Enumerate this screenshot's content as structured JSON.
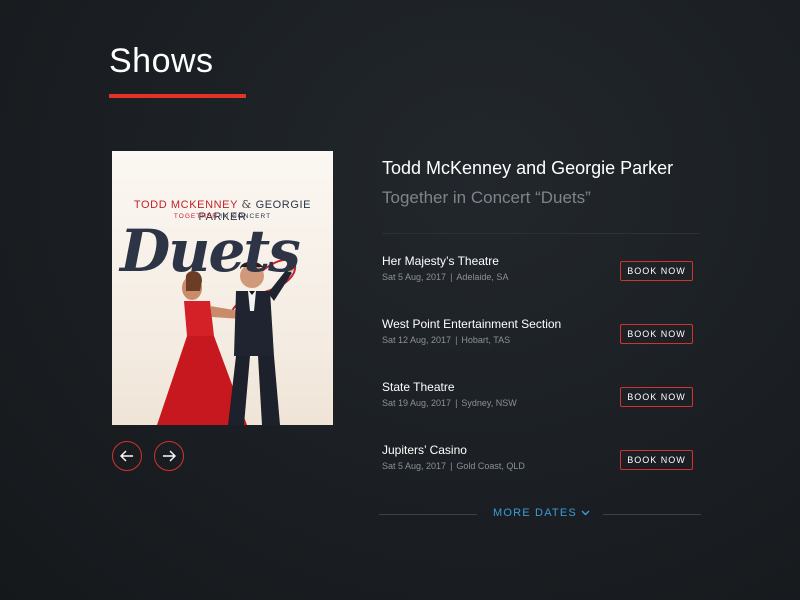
{
  "page": {
    "title": "Shows"
  },
  "poster": {
    "artist_1": "TODD MCKENNEY",
    "ampersand": "&",
    "artist_2": "GEORGIE PARKER",
    "sub_1": "TOGETHER",
    "sub_2": "IN",
    "sub_3": "CONCERT",
    "logo": "Duets"
  },
  "show": {
    "title": "Todd McKenney and Georgie Parker",
    "subtitle": "Together in Concert “Duets”"
  },
  "dates": [
    {
      "venue": "Her Majesty’s Theatre",
      "date": "Sat 5 Aug, 2017",
      "location": "Adelaide, SA",
      "cta": "BOOK NOW"
    },
    {
      "venue": "West Point Entertainment Section",
      "date": "Sat 12 Aug, 2017",
      "location": "Hobart, TAS",
      "cta": "BOOK NOW"
    },
    {
      "venue": "State Theatre",
      "date": "Sat 19 Aug, 2017",
      "location": "Sydney, NSW",
      "cta": "BOOK NOW"
    },
    {
      "venue": "Jupiters’ Casino",
      "date": "Sat 5 Aug, 2017",
      "location": "Gold Coast, QLD",
      "cta": "BOOK NOW"
    }
  ],
  "meta_separator": "|",
  "more": {
    "label": "MORE DATES"
  },
  "icons": {
    "prev": "arrow-left-icon",
    "next": "arrow-right-icon",
    "more": "chevron-down-icon"
  },
  "colors": {
    "accent_red": "#e0342b",
    "link_blue": "#3a9bd6",
    "background": "#1a1e22"
  }
}
